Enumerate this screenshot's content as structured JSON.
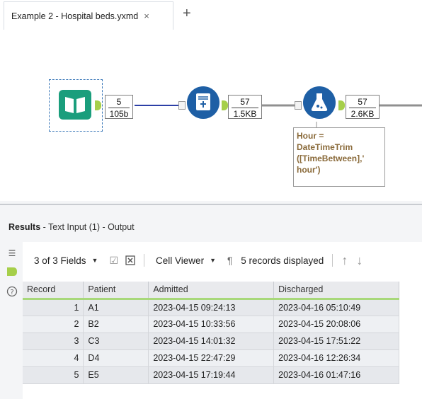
{
  "tab": {
    "title": "Example 2 - Hospital beds.yxmd",
    "close": "×",
    "add": "+"
  },
  "workflow": {
    "badges": [
      {
        "top": "5",
        "bottom": "105b"
      },
      {
        "top": "57",
        "bottom": "1.5KB"
      },
      {
        "top": "57",
        "bottom": "2.6KB"
      }
    ],
    "annotation": [
      "Hour =",
      "DateTimeTrim",
      "([TimeBetween],'",
      "hour')"
    ],
    "icons": [
      "text-input-tool-icon",
      "summarize-tool-icon",
      "formula-tool-icon"
    ],
    "colors": {
      "input_tool": "#1a9e7c",
      "process_tool": "#1e5fa5",
      "anchor": "#a6cf4a",
      "connector": "#2c3fa6"
    }
  },
  "results": {
    "title_bold": "Results",
    "title_rest": " - Text Input (1) - Output",
    "toolbar": {
      "fields": "3 of 3 Fields",
      "viewer": "Cell Viewer",
      "pilcrow": "¶",
      "records": "5 records displayed"
    },
    "columns": [
      "Record",
      "Patient",
      "Admitted",
      "Discharged"
    ],
    "rows": [
      [
        "1",
        "A1",
        "2023-04-15 09:24:13",
        "2023-04-16 05:10:49"
      ],
      [
        "2",
        "B2",
        "2023-04-15 10:33:56",
        "2023-04-15 20:08:06"
      ],
      [
        "3",
        "C3",
        "2023-04-15 14:01:32",
        "2023-04-15 17:51:22"
      ],
      [
        "4",
        "D4",
        "2023-04-15 22:47:29",
        "2023-04-16 12:26:34"
      ],
      [
        "5",
        "E5",
        "2023-04-15 17:19:44",
        "2023-04-16 01:47:16"
      ]
    ]
  }
}
